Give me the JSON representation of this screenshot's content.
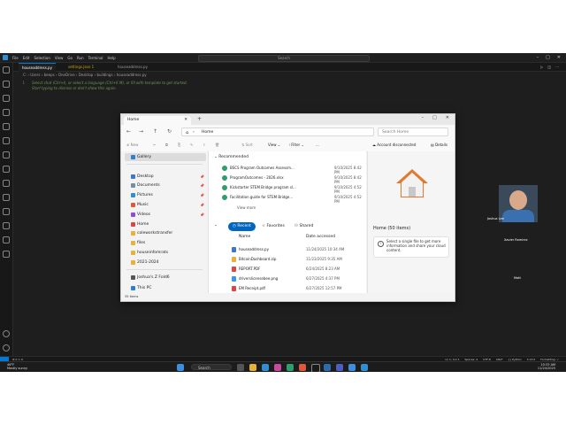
{
  "vscode": {
    "menu": [
      "File",
      "Edit",
      "Selection",
      "View",
      "Go",
      "Run",
      "Terminal",
      "Help"
    ],
    "search": "Search",
    "tabs": [
      "houseaddress.py",
      "settings.json 1",
      "houseaddress.py"
    ],
    "breadcrumb": "C: › Users › beeps › OneDrive › Desktop › buildings › houseaddress.py",
    "code_lines": [
      "Select chat (Ctrl+I), or select a language (Ctrl+K M), or fill with template to get started.",
      "Start typing to dismiss or don't show this again."
    ],
    "status_left": "⊗ 0 ⚠ 0",
    "status_right": [
      "Ln 1, Col 1",
      "Spaces: 4",
      "UTF-8",
      "CRLF",
      "{} Python",
      "3.13.0",
      "Formatting: ✓"
    ]
  },
  "taskbar": {
    "weather_temp": "46°F",
    "weather_desc": "Mostly sunny",
    "search": "Search",
    "time": "10:33 AM",
    "date": "11/24/2025"
  },
  "explorer": {
    "tab_title": "Home",
    "address": "Home",
    "search_placeholder": "Search Home",
    "commands": [
      "New",
      "Sort",
      "View",
      "Filter",
      "..."
    ],
    "account": "Account disconnected",
    "details": "Details",
    "sidebar": [
      {
        "label": "Gallery",
        "color": "#2f7fd0",
        "pinned": false,
        "selected": true
      },
      {
        "label": "Desktop",
        "color": "#3a78c9",
        "pinned": true
      },
      {
        "label": "Documents",
        "color": "#7a8ba0",
        "pinned": true
      },
      {
        "label": "Pictures",
        "color": "#2f8fd0",
        "pinned": true
      },
      {
        "label": "Music",
        "color": "#e0573a",
        "pinned": true
      },
      {
        "label": "Videos",
        "color": "#8a4fd0",
        "pinned": true
      },
      {
        "label": "Home",
        "color": "#d44",
        "pinned": false
      },
      {
        "label": "coleworkstransfer",
        "color": "#e8b23a",
        "pinned": false
      },
      {
        "label": "files",
        "color": "#e8b23a",
        "pinned": false
      },
      {
        "label": "houseinfomrats",
        "color": "#e8b23a",
        "pinned": false
      },
      {
        "label": "2021-2024",
        "color": "#e8b23a",
        "pinned": false
      },
      {
        "label": "Joshua's Z Fold6",
        "color": "#555",
        "pinned": false
      },
      {
        "label": "This PC",
        "color": "#2f7fd0",
        "pinned": false
      }
    ],
    "items_count": "35 items",
    "recommended_title": "Recommended",
    "recommended": [
      {
        "name": "BSCS Program Outcomes Assessm...",
        "date": "9/10/2025 8:42 PM"
      },
      {
        "name": "ProgramOutcomes - 2026.xlsx",
        "date": "9/10/2025 8:42 PM"
      },
      {
        "name": "Kickstarter STEM Bridge program sl...",
        "date": "9/10/2025 4:52 PM"
      },
      {
        "name": "Facilitation guide for STEM Bridge...",
        "date": "9/10/2025 4:52 PM"
      }
    ],
    "view_more": "View more",
    "pivots": [
      "Recent",
      "Favorites",
      "Shared"
    ],
    "columns": [
      "Name",
      "Date accessed"
    ],
    "recent": [
      {
        "name": "houseaddress.py",
        "date": "11/24/2025 10:34 AM",
        "color": "#3a78c9"
      },
      {
        "name": "BitcoinDashboard.zip",
        "date": "11/23/2025 9:35 AM",
        "color": "#e8b23a"
      },
      {
        "name": "REPORT.PDF",
        "date": "6/24/2025 8:23 AM",
        "color": "#d44"
      },
      {
        "name": "driverslicensebee.png",
        "date": "6/27/2025 4:37 PM",
        "color": "#3a9ad9"
      },
      {
        "name": "EM Receipt.pdf",
        "date": "6/27/2025 12:57 PM",
        "color": "#d44"
      }
    ],
    "detail_title": "Home (50 items)",
    "detail_text": "Select a single file to get more information and share your cloud content."
  },
  "webcam": {
    "participants": [
      "Joshua Lee",
      "Xavier Ramirez",
      "Matt"
    ]
  }
}
